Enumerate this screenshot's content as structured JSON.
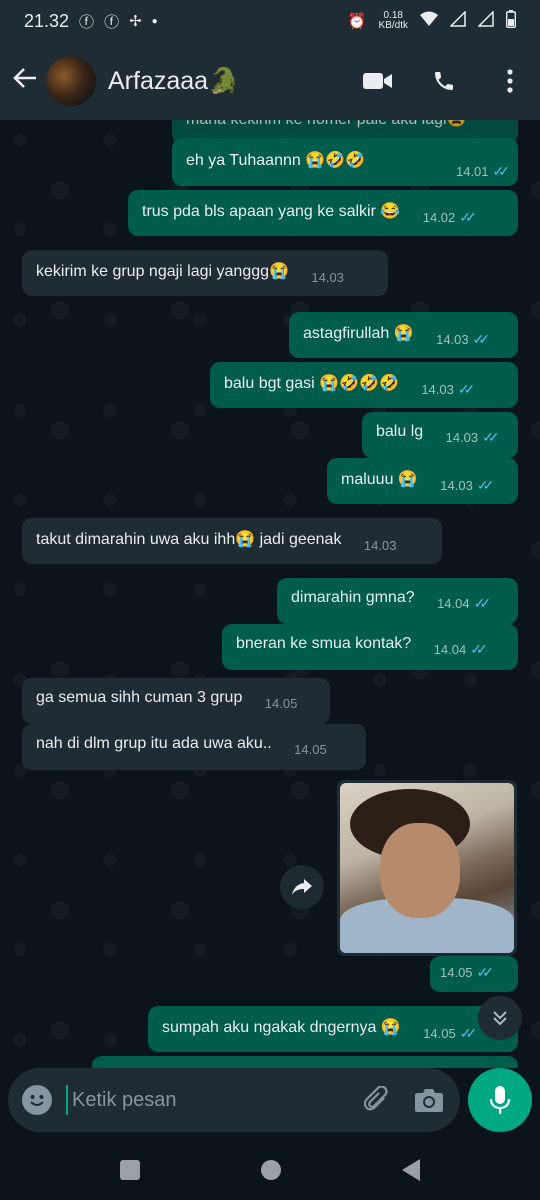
{
  "status_bar": {
    "time": "21.32",
    "left_icons": [
      "facebook-icon",
      "facebook-icon",
      "pinwheel-icon",
      "dot-icon"
    ],
    "net_speed_value": "0.18",
    "net_speed_unit": "KB/dtk",
    "right_icons": [
      "alarm-icon",
      "wifi-icon",
      "signal-icon",
      "signal-icon",
      "battery-icon"
    ]
  },
  "header": {
    "contact_name": "Arfazaaa🐊",
    "icons": [
      "back-arrow-icon",
      "video-call-icon",
      "phone-call-icon",
      "more-vert-icon"
    ]
  },
  "messages": [
    {
      "dir": "out",
      "text": "mana kekirim ke nomer pale aku lagi😩",
      "time": ""
    },
    {
      "dir": "out",
      "text": "eh ya Tuhaannn 😭🤣🤣",
      "time": "14.01",
      "status": "read"
    },
    {
      "dir": "out",
      "text": "trus pda bls apaan yang ke salkir 😂",
      "time": "14.02",
      "status": "read"
    },
    {
      "dir": "in",
      "text": "kekirim ke grup ngaji lagi yanggg😭",
      "time": "14.03"
    },
    {
      "dir": "out",
      "text": "astagfirullah 😭",
      "time": "14.03",
      "status": "read"
    },
    {
      "dir": "out",
      "text": "balu bgt gasi 😭🤣🤣🤣",
      "time": "14.03",
      "status": "read"
    },
    {
      "dir": "out",
      "text": "balu lg",
      "time": "14.03",
      "status": "read"
    },
    {
      "dir": "out",
      "text": "maluuu 😭",
      "time": "14.03",
      "status": "read"
    },
    {
      "dir": "in",
      "text": "takut dimarahin uwa aku ihh😭 jadi geenak",
      "time": "14.03"
    },
    {
      "dir": "out",
      "text": "dimarahin gmna?",
      "time": "14.04",
      "status": "read"
    },
    {
      "dir": "out",
      "text": "bneran ke smua kontak?",
      "time": "14.04",
      "status": "read"
    },
    {
      "dir": "in",
      "text": "ga semua sihh cuman 3 grup",
      "time": "14.05"
    },
    {
      "dir": "in",
      "text": "nah di dlm grup itu ada uwa aku..",
      "time": "14.05"
    },
    {
      "dir": "out",
      "type": "image",
      "time": "14.05",
      "status": "read"
    },
    {
      "dir": "out",
      "text": "sumpah aku ngakak dngernya 😭",
      "time": "14.05",
      "status": "read"
    }
  ],
  "ticks": "✓✓",
  "input": {
    "placeholder": "Ketik pesan",
    "icons": [
      "emoji-icon",
      "attach-icon",
      "camera-icon",
      "mic-icon"
    ]
  },
  "colors": {
    "outgoing_bubble": "#005c4b",
    "incoming_bubble": "#202c33",
    "background": "#0b141a",
    "header": "#1f2c34",
    "accent": "#00a884",
    "read_ticks": "#53bdeb"
  }
}
